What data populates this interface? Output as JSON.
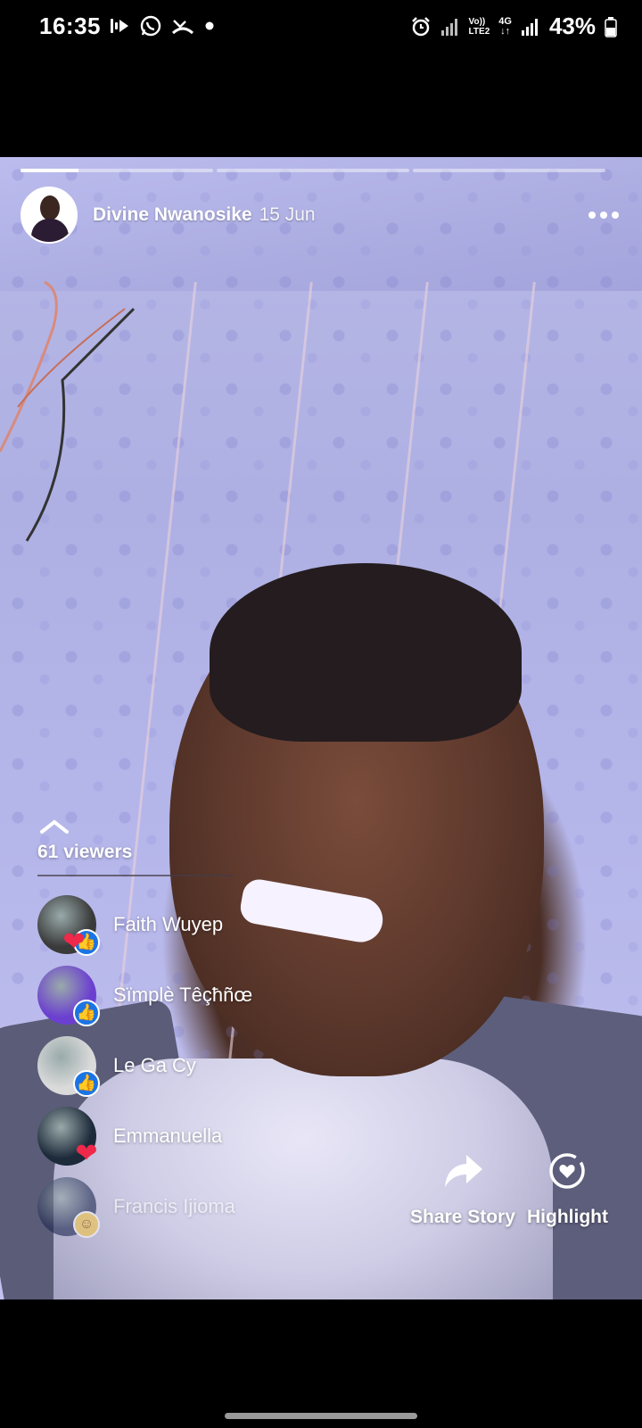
{
  "status_bar": {
    "time": "16:35",
    "battery_percent": "43%",
    "network_volte_top": "Vo))",
    "network_volte_bottom": "LTE2",
    "network_type": "4G",
    "left_icons": [
      "media-icon",
      "whatsapp-icon",
      "missed-call-icon",
      "dot-icon"
    ],
    "right_icons": [
      "alarm-icon",
      "signal-icon",
      "signal-icon",
      "battery-icon"
    ]
  },
  "story": {
    "progress": {
      "segments": 3,
      "active_index": 0,
      "active_fraction": 0.3
    },
    "author": {
      "name": "Divine Nwanosike",
      "date": "15 Jun"
    },
    "viewers": {
      "count_label": "61 viewers",
      "list": [
        {
          "name": "Faith Wuyep",
          "reaction": "heart",
          "extra_reaction": "like",
          "avatar_color": "#3a3a3a"
        },
        {
          "name": "Sïmplè Têçħñœ",
          "reaction": "like",
          "avatar_color": "#6b3fd0"
        },
        {
          "name": "Le Ga Cy",
          "reaction": "like",
          "avatar_color": "#dadada"
        },
        {
          "name": "Emmanuella",
          "reaction": "heart",
          "avatar_color": "#1d2a3a"
        },
        {
          "name": "Francis Ijioma",
          "reaction": "haha",
          "avatar_color": "#1d2850"
        }
      ]
    },
    "actions": {
      "share_label": "Share Story",
      "highlight_label": "Highlight"
    }
  }
}
